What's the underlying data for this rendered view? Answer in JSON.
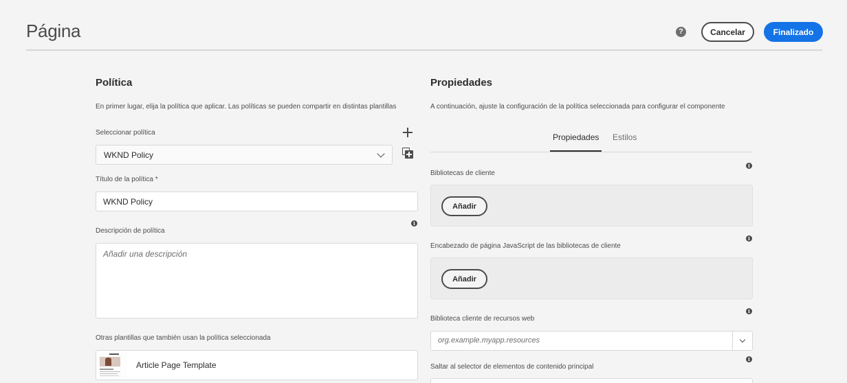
{
  "header": {
    "title": "Página",
    "help_icon": "help-icon",
    "cancel_label": "Cancelar",
    "done_label": "Finalizado",
    "accent_color": "#1473e6"
  },
  "policy": {
    "heading": "Política",
    "description": "En primer lugar, elija la política que aplicar. Las políticas se pueden compartir en distintas plantillas",
    "select_label": "Seleccionar política",
    "select_value": "WKND Policy",
    "title_label": "Título de la política *",
    "title_value": "WKND Policy",
    "desc_label": "Descripción de política",
    "desc_placeholder": "Añadir una descripción",
    "other_templates_label": "Otras plantillas que también usan la política seleccionada",
    "templates": [
      {
        "name": "Article Page Template"
      }
    ]
  },
  "properties": {
    "heading": "Propiedades",
    "description": "A continuación, ajuste la configuración de la política seleccionada para configurar el componente",
    "tabs": [
      {
        "label": "Propiedades",
        "active": true
      },
      {
        "label": "Estilos",
        "active": false
      }
    ],
    "client_libs_label": "Bibliotecas de cliente",
    "add_label": "Añadir",
    "head_js_label": "Encabezado de página JavaScript de las bibliotecas de cliente",
    "web_resources_label": "Biblioteca cliente de recursos web",
    "web_resources_value": "org.example.myapp.resources",
    "skip_main_label": "Saltar al selector de elementos de contenido principal"
  }
}
